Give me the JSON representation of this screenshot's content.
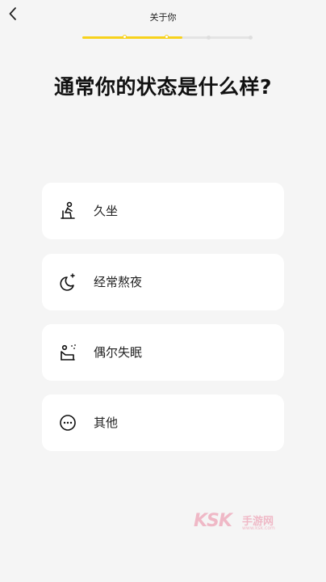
{
  "header": {
    "title": "关于你",
    "progress": {
      "total_steps": 5,
      "current_step": 3,
      "fill_fraction": 0.59
    }
  },
  "question": "通常你的状态是什么样?",
  "options": [
    {
      "label": "久坐",
      "icon": "sitting-person-icon"
    },
    {
      "label": "经常熬夜",
      "icon": "moon-star-icon"
    },
    {
      "label": "偶尔失眠",
      "icon": "sleeping-person-icon"
    },
    {
      "label": "其他",
      "icon": "more-dots-icon"
    }
  ],
  "watermark": {
    "logo": "KSK",
    "side_text": "手游网",
    "url": "www.ksk.com"
  },
  "colors": {
    "accent": "#f7d21c",
    "background": "#f5f5f5",
    "card": "#ffffff",
    "text": "#111111"
  }
}
